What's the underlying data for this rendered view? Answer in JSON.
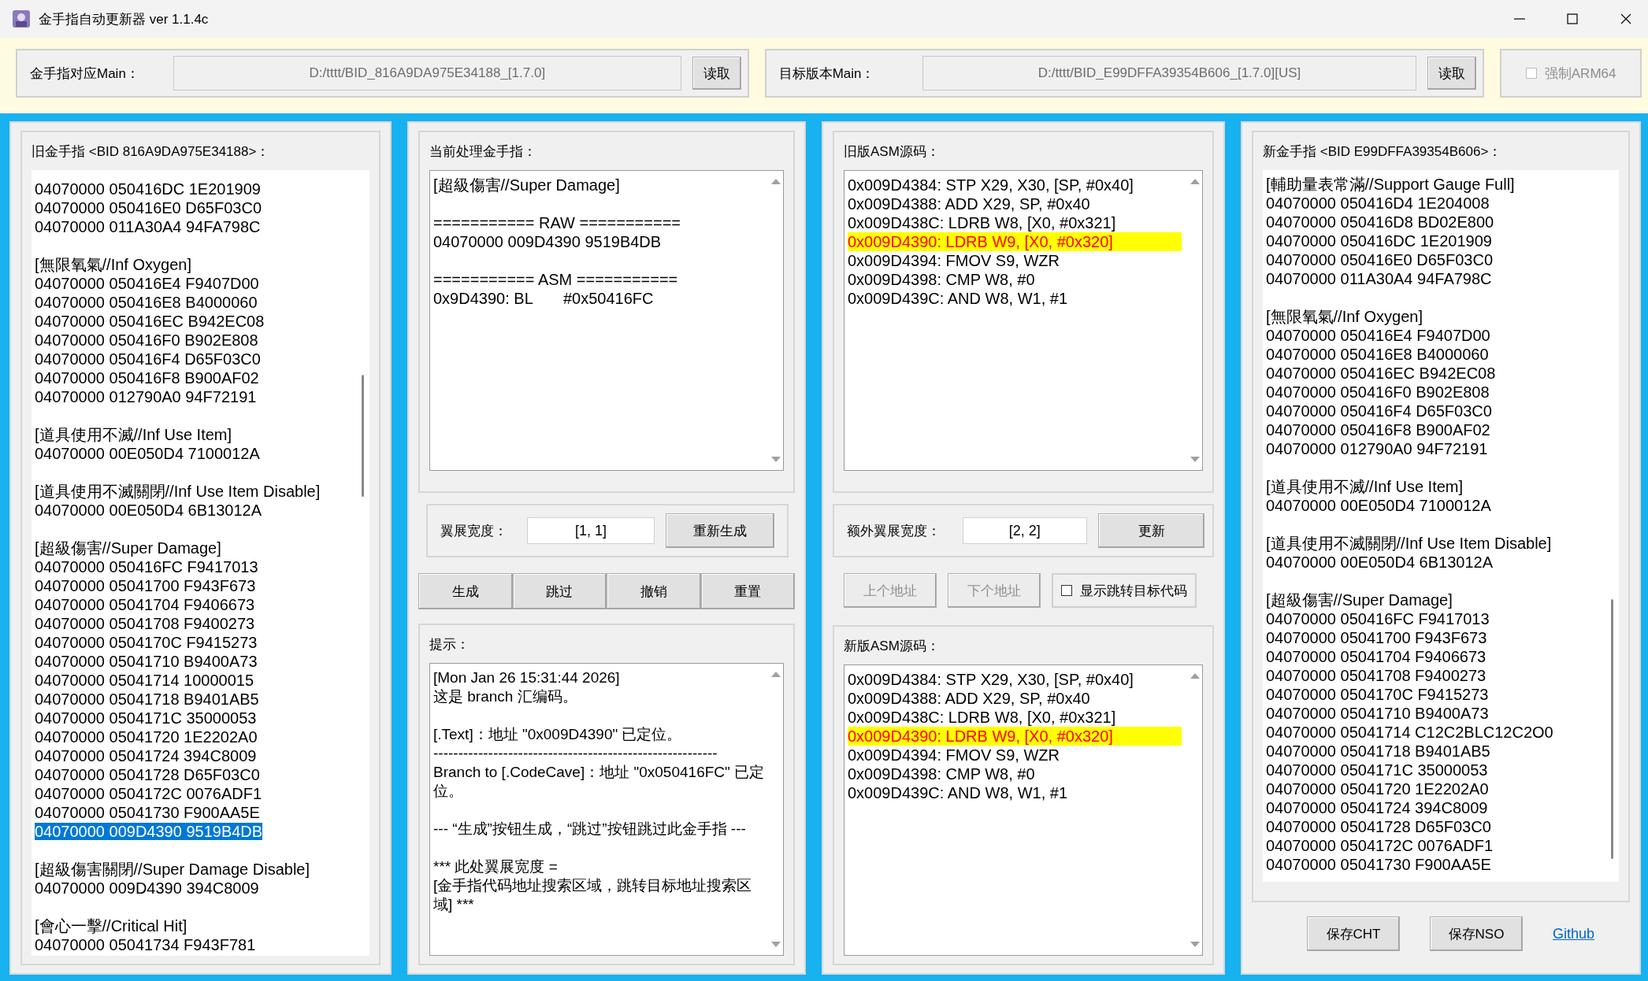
{
  "window": {
    "title": "金手指自动更新器 ver 1.1.4c"
  },
  "source_main": {
    "label": "金手指对应Main：",
    "value": "D:/tttt/BID_816A9DA975E34188_[1.7.0]",
    "button": "读取"
  },
  "target_main": {
    "label": "目标版本Main：",
    "value": "D:/tttt/BID_E99DFFA39354B606_[1.7.0][US]",
    "button": "读取"
  },
  "force_arm64": {
    "label": "强制ARM64",
    "checked": false,
    "disabled": true
  },
  "old_cheats": {
    "title": "旧金手指 <BID 816A9DA975E34188>：",
    "groups": [
      {
        "lines": [
          {
            "text": "04070000 050416DC 1E201909",
            "selected": false
          },
          {
            "text": "04070000 050416E0 D65F03C0",
            "selected": false
          },
          {
            "text": "04070000 011A30A4 94FA798C",
            "selected": false
          }
        ]
      },
      {
        "lines": [
          {
            "text": "[無限氧氣//Inf Oxygen]",
            "selected": false
          },
          {
            "text": "04070000 050416E4 F9407D00",
            "selected": false
          },
          {
            "text": "04070000 050416E8 B4000060",
            "selected": false
          },
          {
            "text": "04070000 050416EC B942EC08",
            "selected": false
          },
          {
            "text": "04070000 050416F0 B902E808",
            "selected": false
          },
          {
            "text": "04070000 050416F4 D65F03C0",
            "selected": false
          },
          {
            "text": "04070000 050416F8 B900AF02",
            "selected": false
          },
          {
            "text": "04070000 012790A0 94F72191",
            "selected": false
          }
        ]
      },
      {
        "lines": [
          {
            "text": "[道具使用不滅//Inf Use Item]",
            "selected": false
          },
          {
            "text": "04070000 00E050D4 7100012A",
            "selected": false
          }
        ]
      },
      {
        "lines": [
          {
            "text": "[道具使用不滅關閉//Inf Use Item Disable]",
            "selected": false
          },
          {
            "text": "04070000 00E050D4 6B13012A",
            "selected": false
          }
        ]
      },
      {
        "lines": [
          {
            "text": "[超級傷害//Super Damage]",
            "selected": false
          },
          {
            "text": "04070000 050416FC F9417013",
            "selected": false
          },
          {
            "text": "04070000 05041700 F943F673",
            "selected": false
          },
          {
            "text": "04070000 05041704 F9406673",
            "selected": false
          },
          {
            "text": "04070000 05041708 F9400273",
            "selected": false
          },
          {
            "text": "04070000 0504170C F9415273",
            "selected": false
          },
          {
            "text": "04070000 05041710 B9400A73",
            "selected": false
          },
          {
            "text": "04070000 05041714 10000015",
            "selected": false
          },
          {
            "text": "04070000 05041718 B9401AB5",
            "selected": false
          },
          {
            "text": "04070000 0504171C 35000053",
            "selected": false
          },
          {
            "text": "04070000 05041720 1E2202A0",
            "selected": false
          },
          {
            "text": "04070000 05041724 394C8009",
            "selected": false
          },
          {
            "text": "04070000 05041728 D65F03C0",
            "selected": false
          },
          {
            "text": "04070000 0504172C 0076ADF1",
            "selected": false
          },
          {
            "text": "04070000 05041730 F900AA5E",
            "selected": false
          },
          {
            "text": "04070000 009D4390 9519B4DB",
            "selected": true
          }
        ]
      },
      {
        "lines": [
          {
            "text": "[超級傷害關閉//Super Damage Disable]",
            "selected": false
          },
          {
            "text": "04070000 009D4390 394C8009",
            "selected": false
          }
        ]
      },
      {
        "lines": [
          {
            "text": "[會心一擊//Critical Hit]",
            "selected": false
          },
          {
            "text": "04070000 05041734 F943F781",
            "selected": false
          }
        ]
      }
    ]
  },
  "current_cheat": {
    "title": "当前处理金手指：",
    "blocks": [
      [
        "[超級傷害//Super Damage]"
      ],
      [
        "=========== RAW ===========",
        "04070000 009D4390 9519B4DB"
      ],
      [
        "=========== ASM ===========",
        "0x9D4390: BL       #0x50416FC"
      ]
    ]
  },
  "span_width": {
    "label": "翼展宽度：",
    "value": "[1, 1]",
    "button": "重新生成"
  },
  "actions": [
    "生成",
    "跳过",
    "撤销",
    "重置"
  ],
  "hints": {
    "title": "提示：",
    "blocks": [
      [
        "[Mon Jan 26 15:31:44 2026]",
        "这是 branch 汇编码。"
      ],
      [
        "[.Text]：地址 \"0x009D4390\" 已定位。",
        "---------------------------------------------------------",
        "Branch to [.CodeCave]：地址 \"0x050416FC\" 已定位。"
      ],
      [
        "--- “生成”按钮生成，“跳过”按钮跳过此金手指 ---"
      ],
      [
        "*** 此处翼展宽度 =",
        "[金手指代码地址搜索区域，跳转目标地址搜索区域] ***"
      ]
    ]
  },
  "old_asm": {
    "title": "旧版ASM源码：",
    "rows": [
      {
        "text": "0x009D4384: STP  X29, X30, [SP, #0x40]",
        "selected": false
      },
      {
        "text": "0x009D4388: ADD X29, SP, #0x40",
        "selected": false
      },
      {
        "text": "0x009D438C: LDRB W8, [X0, #0x321]",
        "selected": false
      },
      {
        "text": "0x009D4390: LDRB W9, [X0, #0x320]",
        "selected": true
      },
      {
        "text": "0x009D4394: FMOV S9, WZR",
        "selected": false
      },
      {
        "text": "0x009D4398: CMP W8, #0",
        "selected": false
      },
      {
        "text": "0x009D439C: AND W8, W1, #1",
        "selected": false
      }
    ]
  },
  "extra_span": {
    "label": "额外翼展宽度：",
    "value": "[2, 2]",
    "button": "更新"
  },
  "nav_buttons": [
    {
      "label": "上个地址",
      "disabled": true
    },
    {
      "label": "下个地址",
      "disabled": true
    }
  ],
  "show_target": {
    "label": "显示跳转目标代码",
    "checked": false
  },
  "new_asm": {
    "title": "新版ASM源码：",
    "rows": [
      {
        "text": "0x009D4384: STP  X29, X30, [SP, #0x40]",
        "selected": false
      },
      {
        "text": "0x009D4388: ADD X29, SP, #0x40",
        "selected": false
      },
      {
        "text": "0x009D438C: LDRB W8, [X0, #0x321]",
        "selected": false
      },
      {
        "text": "0x009D4390: LDRB W9, [X0, #0x320]",
        "selected": true
      },
      {
        "text": "0x009D4394: FMOV S9, WZR",
        "selected": false
      },
      {
        "text": "0x009D4398: CMP W8, #0",
        "selected": false
      },
      {
        "text": "0x009D439C: AND W8, W1, #1",
        "selected": false
      }
    ]
  },
  "new_cheats": {
    "title": "新金手指 <BID E99DFFA39354B606>：",
    "groups": [
      {
        "lines": [
          {
            "text": "[輔助量表常滿//Support Gauge Full]",
            "selected": false
          },
          {
            "text": "04070000 050416D4 1E204008",
            "selected": false
          },
          {
            "text": "04070000 050416D8 BD02E800",
            "selected": false
          },
          {
            "text": "04070000 050416DC 1E201909",
            "selected": false
          },
          {
            "text": "04070000 050416E0 D65F03C0",
            "selected": false
          },
          {
            "text": "04070000 011A30A4 94FA798C",
            "selected": false
          }
        ]
      },
      {
        "lines": [
          {
            "text": "[無限氧氣//Inf Oxygen]",
            "selected": false
          },
          {
            "text": "04070000 050416E4 F9407D00",
            "selected": false
          },
          {
            "text": "04070000 050416E8 B4000060",
            "selected": false
          },
          {
            "text": "04070000 050416EC B942EC08",
            "selected": false
          },
          {
            "text": "04070000 050416F0 B902E808",
            "selected": false
          },
          {
            "text": "04070000 050416F4 D65F03C0",
            "selected": false
          },
          {
            "text": "04070000 050416F8 B900AF02",
            "selected": false
          },
          {
            "text": "04070000 012790A0 94F72191",
            "selected": false
          }
        ]
      },
      {
        "lines": [
          {
            "text": "[道具使用不滅//Inf Use Item]",
            "selected": false
          },
          {
            "text": "04070000 00E050D4 7100012A",
            "selected": false
          }
        ]
      },
      {
        "lines": [
          {
            "text": "[道具使用不滅關閉//Inf Use Item Disable]",
            "selected": false
          },
          {
            "text": "04070000 00E050D4 6B13012A",
            "selected": false
          }
        ]
      },
      {
        "lines": [
          {
            "text": "[超級傷害//Super Damage]",
            "selected": false
          },
          {
            "text": "04070000 050416FC F9417013",
            "selected": false
          },
          {
            "text": "04070000 05041700 F943F673",
            "selected": false
          },
          {
            "text": "04070000 05041704 F9406673",
            "selected": false
          },
          {
            "text": "04070000 05041708 F9400273",
            "selected": false
          },
          {
            "text": "04070000 0504170C F9415273",
            "selected": false
          },
          {
            "text": "04070000 05041710 B9400A73",
            "selected": false
          },
          {
            "text": "04070000 05041714 C12C2BLC12C2O0",
            "selected": false
          },
          {
            "text": "04070000 05041718 B9401AB5",
            "selected": false
          },
          {
            "text": "04070000 0504171C 35000053",
            "selected": false
          },
          {
            "text": "04070000 05041720 1E2202A0",
            "selected": false
          },
          {
            "text": "04070000 05041724 394C8009",
            "selected": false
          },
          {
            "text": "04070000 05041728 D65F03C0",
            "selected": false
          },
          {
            "text": "04070000 0504172C 0076ADF1",
            "selected": false
          },
          {
            "text": "04070000 05041730 F900AA5E",
            "selected": false
          }
        ]
      }
    ]
  },
  "save_buttons": [
    "保存CHT",
    "保存NSO"
  ],
  "link": "Github"
}
